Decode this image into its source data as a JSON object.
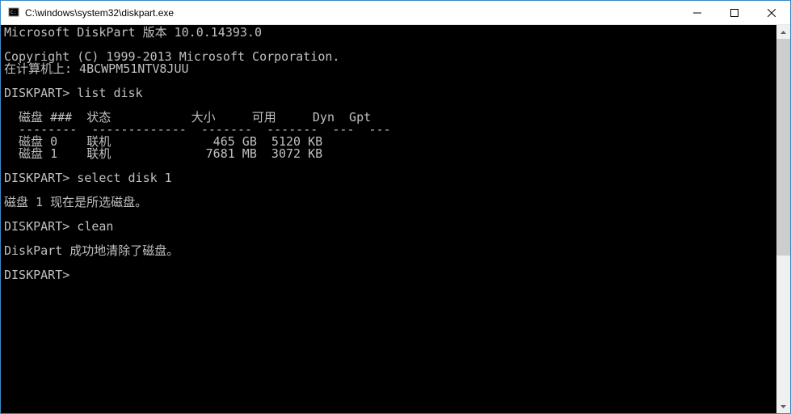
{
  "titlebar": {
    "title": "C:\\windows\\system32\\diskpart.exe"
  },
  "console": {
    "version_line": "Microsoft DiskPart 版本 10.0.14393.0",
    "blank": "",
    "copyright_line": "Copyright (C) 1999-2013 Microsoft Corporation.",
    "computer_line": "在计算机上: 4BCWPM51NTV8JUU",
    "prompt1": "DISKPART> list disk",
    "header_line": "  磁盘 ###  状态           大小     可用     Dyn  Gpt",
    "separator_line": "  --------  -------------  -------  -------  ---  ---",
    "disk0_line": "  磁盘 0    联机              465 GB  5120 KB",
    "disk1_line": "  磁盘 1    联机             7681 MB  3072 KB",
    "prompt2": "DISKPART> select disk 1",
    "selected_line": "磁盘 1 现在是所选磁盘。",
    "prompt3": "DISKPART> clean",
    "clean_success": "DiskPart 成功地清除了磁盘。",
    "prompt4": "DISKPART> "
  }
}
